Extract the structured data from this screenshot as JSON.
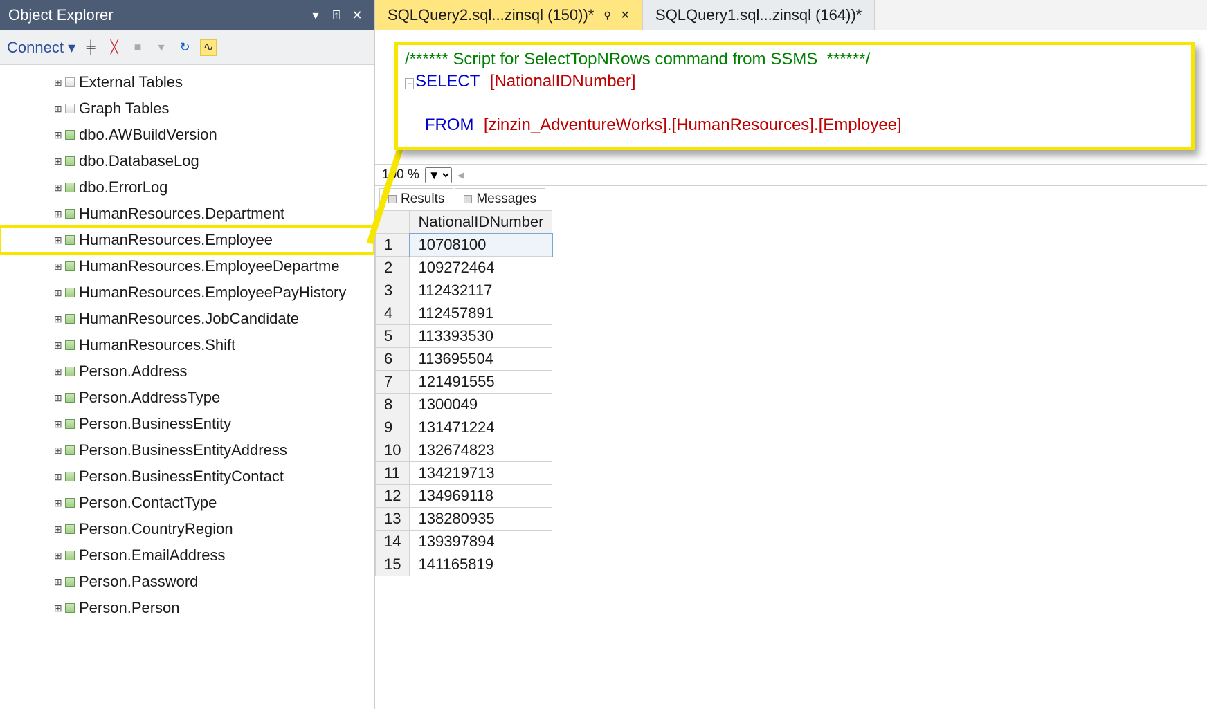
{
  "objectExplorer": {
    "title": "Object Explorer",
    "connectLabel": "Connect",
    "items": [
      {
        "label": "External Tables",
        "folder": true
      },
      {
        "label": "Graph Tables",
        "folder": true
      },
      {
        "label": "dbo.AWBuildVersion"
      },
      {
        "label": "dbo.DatabaseLog"
      },
      {
        "label": "dbo.ErrorLog"
      },
      {
        "label": "HumanResources.Department"
      },
      {
        "label": "HumanResources.Employee",
        "highlight": true
      },
      {
        "label": "HumanResources.EmployeeDepartme"
      },
      {
        "label": "HumanResources.EmployeePayHistory"
      },
      {
        "label": "HumanResources.JobCandidate"
      },
      {
        "label": "HumanResources.Shift"
      },
      {
        "label": "Person.Address"
      },
      {
        "label": "Person.AddressType"
      },
      {
        "label": "Person.BusinessEntity"
      },
      {
        "label": "Person.BusinessEntityAddress"
      },
      {
        "label": "Person.BusinessEntityContact"
      },
      {
        "label": "Person.ContactType"
      },
      {
        "label": "Person.CountryRegion"
      },
      {
        "label": "Person.EmailAddress"
      },
      {
        "label": "Person.Password"
      },
      {
        "label": "Person.Person"
      }
    ]
  },
  "tabs": [
    {
      "label": "SQLQuery2.sql...zinsql (150))*",
      "active": true,
      "pinned": true
    },
    {
      "label": "SQLQuery1.sql...zinsql (164))*"
    }
  ],
  "editor": {
    "commentLine": "/****** Script for SelectTopNRows command from SSMS  ******/",
    "selectKw": "SELECT",
    "selectCol": "[NationalIDNumber]",
    "fromKw": "FROM",
    "fromBody": "[zinzin_AdventureWorks].[HumanResources].[Employee]"
  },
  "zoom": "100 %",
  "resultTabs": {
    "results": "Results",
    "messages": "Messages"
  },
  "grid": {
    "column": "NationalIDNumber",
    "rows": [
      "10708100",
      "109272464",
      "112432117",
      "112457891",
      "113393530",
      "113695504",
      "121491555",
      "1300049",
      "131471224",
      "132674823",
      "134219713",
      "134969118",
      "138280935",
      "139397894",
      "141165819"
    ]
  }
}
